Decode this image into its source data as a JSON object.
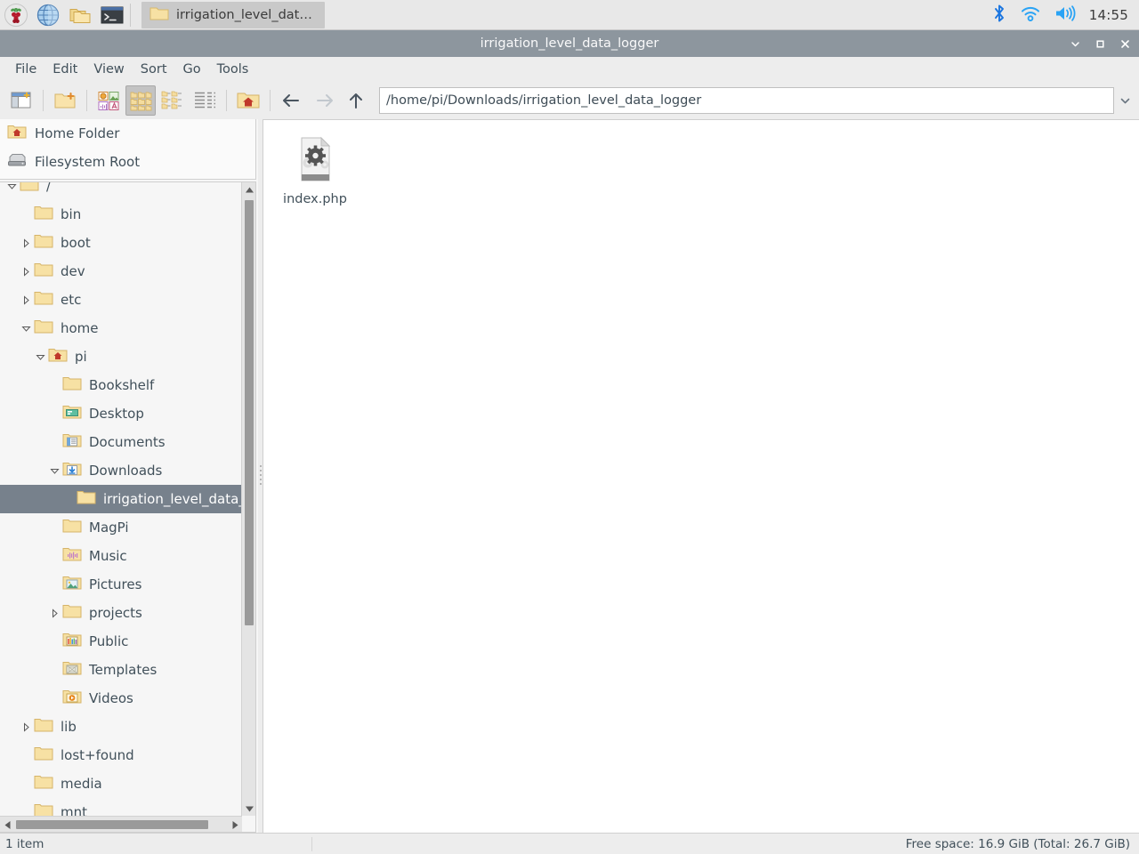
{
  "taskbar": {
    "launchers": [
      {
        "name": "raspberry-menu-icon",
        "label": "Menu"
      },
      {
        "name": "web-browser-icon",
        "label": "Web Browser"
      },
      {
        "name": "file-manager-icon",
        "label": "File Manager"
      },
      {
        "name": "terminal-icon",
        "label": "Terminal"
      }
    ],
    "window_button": {
      "label": "irrigation_level_data_l…",
      "icon": "folder-icon"
    },
    "tray": [
      {
        "name": "bluetooth-icon",
        "color": "#1a75e0"
      },
      {
        "name": "wifi-icon",
        "color": "#29a3f5"
      },
      {
        "name": "volume-icon",
        "color": "#29a3f5"
      }
    ],
    "clock": "14:55"
  },
  "window": {
    "title": "irrigation_level_data_logger",
    "titlebar_color": "#8d969e",
    "controls": [
      {
        "name": "minimize-button",
        "glyph": "⌄"
      },
      {
        "name": "maximize-button",
        "glyph": "□"
      },
      {
        "name": "close-button",
        "glyph": "✕"
      }
    ]
  },
  "menubar": {
    "items": [
      {
        "label": "File"
      },
      {
        "label": "Edit"
      },
      {
        "label": "View"
      },
      {
        "label": "Sort"
      },
      {
        "label": "Go"
      },
      {
        "label": "Tools"
      }
    ]
  },
  "toolbar": {
    "buttons": [
      {
        "name": "new-window-button",
        "icon": "new-window-icon",
        "pressed": false
      },
      {
        "name": "new-folder-button",
        "icon": "new-folder-icon",
        "pressed": false
      },
      {
        "name": "thumbnail-view-button",
        "icon": "thumbnail-view-icon",
        "pressed": false
      },
      {
        "name": "icon-view-button",
        "icon": "icon-view-icon",
        "pressed": true
      },
      {
        "name": "compact-view-button",
        "icon": "compact-view-icon",
        "pressed": false
      },
      {
        "name": "detailed-list-view-button",
        "icon": "detailed-list-icon",
        "pressed": false
      },
      {
        "name": "home-button",
        "icon": "home-folder-icon",
        "pressed": false
      }
    ],
    "nav": {
      "back": {
        "name": "back-button",
        "enabled": true
      },
      "forward": {
        "name": "forward-button",
        "enabled": false
      },
      "up": {
        "name": "up-button",
        "enabled": true
      }
    },
    "path": {
      "value": "/home/pi/Downloads/irrigation_level_data_logger",
      "placeholder": "Path"
    }
  },
  "sidebar": {
    "places": [
      {
        "label": "Home Folder",
        "icon": "home-folder-icon"
      },
      {
        "label": "Filesystem Root",
        "icon": "drive-icon"
      }
    ],
    "tree": [
      {
        "label": "/",
        "depth": 0,
        "icon": "folder-icon",
        "state": "expanded",
        "selected": false
      },
      {
        "label": "bin",
        "depth": 1,
        "icon": "folder-icon",
        "state": "leaf",
        "selected": false
      },
      {
        "label": "boot",
        "depth": 1,
        "icon": "folder-icon",
        "state": "collapsed",
        "selected": false
      },
      {
        "label": "dev",
        "depth": 1,
        "icon": "folder-icon",
        "state": "collapsed",
        "selected": false
      },
      {
        "label": "etc",
        "depth": 1,
        "icon": "folder-icon",
        "state": "collapsed",
        "selected": false
      },
      {
        "label": "home",
        "depth": 1,
        "icon": "folder-icon",
        "state": "expanded",
        "selected": false
      },
      {
        "label": "pi",
        "depth": 2,
        "icon": "home-folder-icon",
        "state": "expanded",
        "selected": false
      },
      {
        "label": "Bookshelf",
        "depth": 3,
        "icon": "folder-icon",
        "state": "leaf",
        "selected": false
      },
      {
        "label": "Desktop",
        "depth": 3,
        "icon": "desktop-folder-icon",
        "state": "leaf",
        "selected": false
      },
      {
        "label": "Documents",
        "depth": 3,
        "icon": "documents-folder-icon",
        "state": "leaf",
        "selected": false
      },
      {
        "label": "Downloads",
        "depth": 3,
        "icon": "downloads-folder-icon",
        "state": "expanded",
        "selected": false
      },
      {
        "label": "irrigation_level_data_logger",
        "depth": 4,
        "icon": "folder-icon",
        "state": "leaf",
        "selected": true
      },
      {
        "label": "MagPi",
        "depth": 3,
        "icon": "folder-icon",
        "state": "leaf",
        "selected": false
      },
      {
        "label": "Music",
        "depth": 3,
        "icon": "music-folder-icon",
        "state": "leaf",
        "selected": false
      },
      {
        "label": "Pictures",
        "depth": 3,
        "icon": "pictures-folder-icon",
        "state": "leaf",
        "selected": false
      },
      {
        "label": "projects",
        "depth": 3,
        "icon": "folder-icon",
        "state": "collapsed",
        "selected": false
      },
      {
        "label": "Public",
        "depth": 3,
        "icon": "public-folder-icon",
        "state": "leaf",
        "selected": false
      },
      {
        "label": "Templates",
        "depth": 3,
        "icon": "templates-folder-icon",
        "state": "leaf",
        "selected": false
      },
      {
        "label": "Videos",
        "depth": 3,
        "icon": "videos-folder-icon",
        "state": "leaf",
        "selected": false
      },
      {
        "label": "lib",
        "depth": 1,
        "icon": "folder-icon",
        "state": "collapsed",
        "selected": false
      },
      {
        "label": "lost+found",
        "depth": 1,
        "icon": "folder-icon",
        "state": "leaf",
        "selected": false
      },
      {
        "label": "media",
        "depth": 1,
        "icon": "folder-icon",
        "state": "leaf",
        "selected": false
      },
      {
        "label": "mnt",
        "depth": 1,
        "icon": "folder-icon",
        "state": "leaf",
        "selected": false
      }
    ]
  },
  "filepane": {
    "items": [
      {
        "name": "index.php",
        "icon": "php-script-file-icon"
      }
    ]
  },
  "statusbar": {
    "left": "1 item",
    "right": "Free space: 16.9 GiB (Total: 26.7 GiB)"
  },
  "colors": {
    "selection": "#77818c",
    "titlebar": "#8d969e",
    "folder_yellow": "#f5dd9a",
    "text": "#41505a"
  }
}
